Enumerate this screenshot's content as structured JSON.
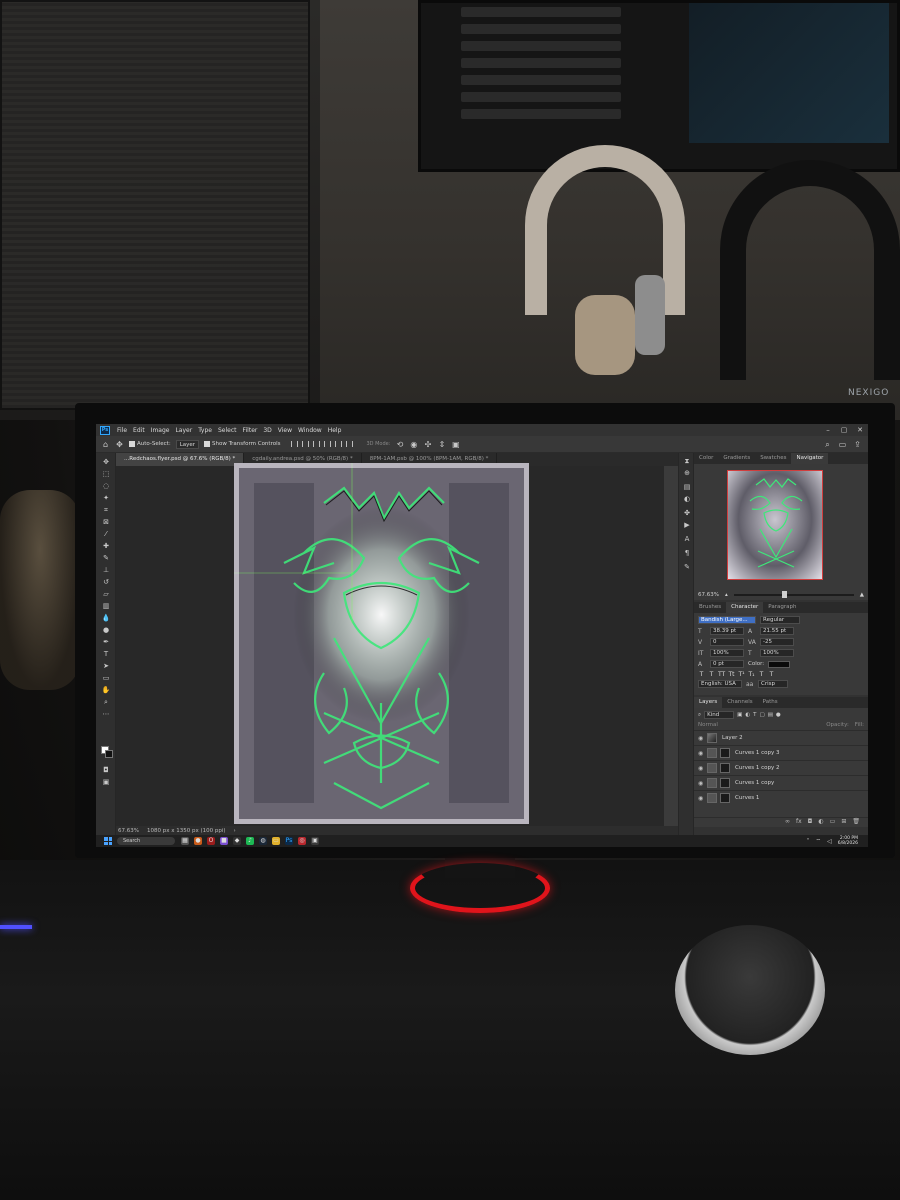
{
  "app": {
    "name": "Adobe Photoshop",
    "menu": [
      "File",
      "Edit",
      "Image",
      "Layer",
      "Type",
      "Select",
      "Filter",
      "3D",
      "View",
      "Window",
      "Help"
    ]
  },
  "options_bar": {
    "auto_select_label": "Auto-Select:",
    "auto_select_value": "Layer",
    "transform_label": "Show Transform Controls",
    "mode_3d": "3D Mode:"
  },
  "tabs": [
    "...Redchaos.flyer.psd @ 67.6% (RGB/8) *",
    "cgdaily.andrea.psd @ 50% (RGB/8) *",
    "8PM-1AM.psb @ 100% (8PM-1AM, RGB/8) *"
  ],
  "status_bar": {
    "zoom": "67.63%",
    "doc_size": "1080 px x 1350 px (100 ppi)"
  },
  "top_panel": {
    "tabs": [
      "Color",
      "Gradients",
      "Swatches",
      "Navigator"
    ],
    "active": "Navigator",
    "zoom": "67.63%"
  },
  "character_panel": {
    "tabs": [
      "Brushes",
      "Character",
      "Paragraph"
    ],
    "font_family": "Bandish (Large...",
    "font_style": "Regular",
    "font_size": "38.39 pt",
    "leading": "21.55 pt",
    "kerning": "0",
    "tracking": "-25",
    "vertical_scale": "100%",
    "horizontal_scale": "100%",
    "baseline": "0 pt",
    "color_label": "Color:",
    "language": "English: USA",
    "antialias_code": "aa",
    "antialias": "Crisp"
  },
  "layers_panel": {
    "tabs": [
      "Layers",
      "Channels",
      "Paths"
    ],
    "filter": "Kind",
    "blend_mode": "Normal",
    "opacity_label": "Opacity:",
    "fill_label": "Fill:",
    "layers": [
      "Layer 2",
      "Curves 1 copy 3",
      "Curves 1 copy 2",
      "Curves 1 copy",
      "Curves 1"
    ]
  },
  "taskbar": {
    "search_placeholder": "Search",
    "time": "2:00 PM",
    "date": "6/8/2026"
  },
  "monitor_brand": "NEXIGO",
  "colors": {
    "ps_blue": "#31a8ff",
    "stand_ring": "#e0141b",
    "art_green": "#3ee87a"
  }
}
